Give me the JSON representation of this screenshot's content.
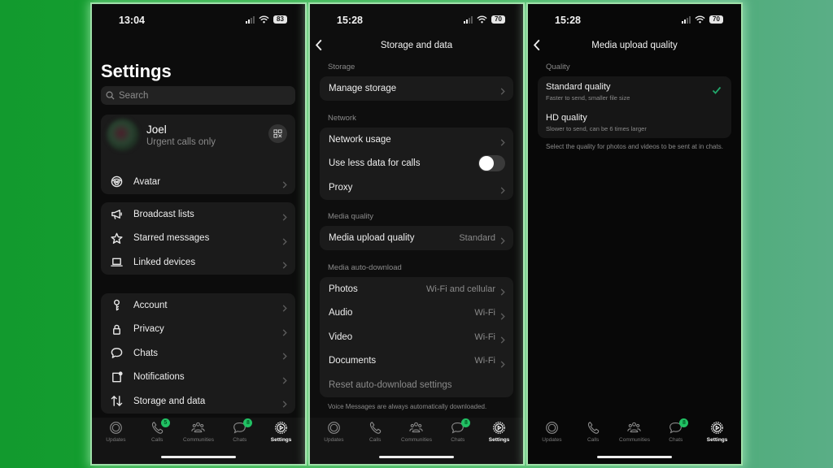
{
  "colors": {
    "accent_green": "#21c063",
    "background_left": "#129a2e",
    "background_right": "#5aae86",
    "panel_bg": "#0c0c0c",
    "card_bg": "#1b1b1b"
  },
  "screen1": {
    "status": {
      "time": "13:04",
      "battery": "83"
    },
    "title": "Settings",
    "search": {
      "placeholder": "Search"
    },
    "profile": {
      "name": "Joel",
      "status": "Urgent calls only",
      "qr_icon": "qr-code-icon"
    },
    "profile_items": [
      {
        "label": "Avatar",
        "icon": "avatar-face-icon"
      }
    ],
    "group1": [
      {
        "label": "Broadcast lists",
        "icon": "megaphone-icon"
      },
      {
        "label": "Starred messages",
        "icon": "star-icon"
      },
      {
        "label": "Linked devices",
        "icon": "laptop-icon"
      }
    ],
    "group2": [
      {
        "label": "Account",
        "icon": "key-icon"
      },
      {
        "label": "Privacy",
        "icon": "lock-icon"
      },
      {
        "label": "Chats",
        "icon": "chat-bubble-icon"
      },
      {
        "label": "Notifications",
        "icon": "notification-icon"
      },
      {
        "label": "Storage and data",
        "icon": "arrows-up-down-icon"
      }
    ],
    "tabs": [
      {
        "label": "Updates",
        "badge": ""
      },
      {
        "label": "Calls",
        "badge": "5"
      },
      {
        "label": "Communities",
        "badge": ""
      },
      {
        "label": "Chats",
        "badge": "8"
      },
      {
        "label": "Settings",
        "badge": "",
        "active": true
      }
    ]
  },
  "screen2": {
    "status": {
      "time": "15:28",
      "battery": "70"
    },
    "nav_title": "Storage and data",
    "storage_label": "Storage",
    "storage_items": [
      {
        "label": "Manage storage"
      }
    ],
    "network_label": "Network",
    "network_items": [
      {
        "label": "Network usage"
      },
      {
        "label": "Use less data for calls",
        "toggle": false
      },
      {
        "label": "Proxy"
      }
    ],
    "media_quality_label": "Media quality",
    "media_quality_items": [
      {
        "label": "Media upload quality",
        "value": "Standard"
      }
    ],
    "auto_download_label": "Media auto-download",
    "auto_download_items": [
      {
        "label": "Photos",
        "value": "Wi-Fi and cellular"
      },
      {
        "label": "Audio",
        "value": "Wi-Fi"
      },
      {
        "label": "Video",
        "value": "Wi-Fi"
      },
      {
        "label": "Documents",
        "value": "Wi-Fi"
      }
    ],
    "reset_label": "Reset auto-download settings",
    "footer": "Voice Messages are always automatically downloaded.",
    "tabs": [
      {
        "label": "Updates",
        "badge": ""
      },
      {
        "label": "Calls",
        "badge": ""
      },
      {
        "label": "Communities",
        "badge": ""
      },
      {
        "label": "Chats",
        "badge": "8"
      },
      {
        "label": "Settings",
        "badge": "",
        "active": true
      }
    ]
  },
  "screen3": {
    "status": {
      "time": "15:28",
      "battery": "70"
    },
    "nav_title": "Media upload quality",
    "quality_label": "Quality",
    "options": [
      {
        "title": "Standard quality",
        "subtitle": "Faster to send, smaller file size",
        "selected": true
      },
      {
        "title": "HD quality",
        "subtitle": "Slower to send, can be 6 times larger",
        "selected": false
      }
    ],
    "footer": "Select the quality for photos and videos to be sent at in chats.",
    "tabs": [
      {
        "label": "Updates",
        "badge": ""
      },
      {
        "label": "Calls",
        "badge": ""
      },
      {
        "label": "Communities",
        "badge": ""
      },
      {
        "label": "Chats",
        "badge": "8"
      },
      {
        "label": "Settings",
        "badge": "",
        "active": true
      }
    ]
  }
}
